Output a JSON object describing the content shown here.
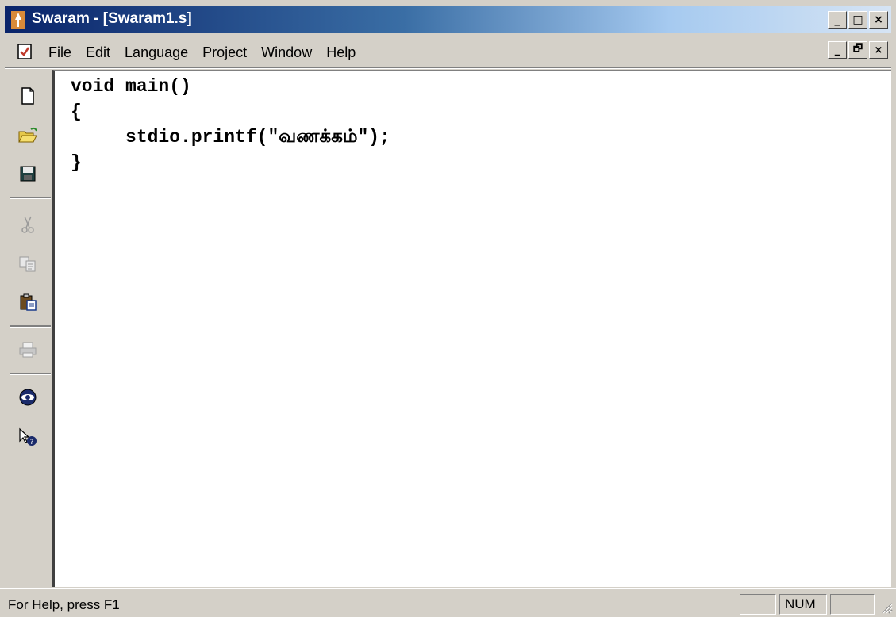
{
  "window": {
    "title": "Swaram - [Swaram1.s]",
    "controls": {
      "minimize": "_",
      "maximize": "□",
      "close": "×"
    }
  },
  "menu": {
    "items": [
      "File",
      "Edit",
      "Language",
      "Project",
      "Window",
      "Help"
    ],
    "mdi_controls": {
      "minimize": "_",
      "restore": "🗗",
      "close": "×"
    }
  },
  "toolbar": {
    "icons": [
      "new-file-icon",
      "open-folder-icon",
      "save-icon",
      "cut-icon",
      "copy-icon",
      "paste-icon",
      "print-icon",
      "compile-icon",
      "help-pointer-icon"
    ]
  },
  "editor": {
    "lines": [
      "void main()",
      "{",
      "     stdio.printf(\"வணக்கம்\");",
      "}"
    ]
  },
  "status": {
    "help_text": "For Help, press F1",
    "panels": [
      "",
      "NUM",
      ""
    ]
  },
  "colors": {
    "title_bar_start": "#0a246a",
    "title_bar_end": "#d6e4f4",
    "chrome": "#d4d0c8"
  }
}
